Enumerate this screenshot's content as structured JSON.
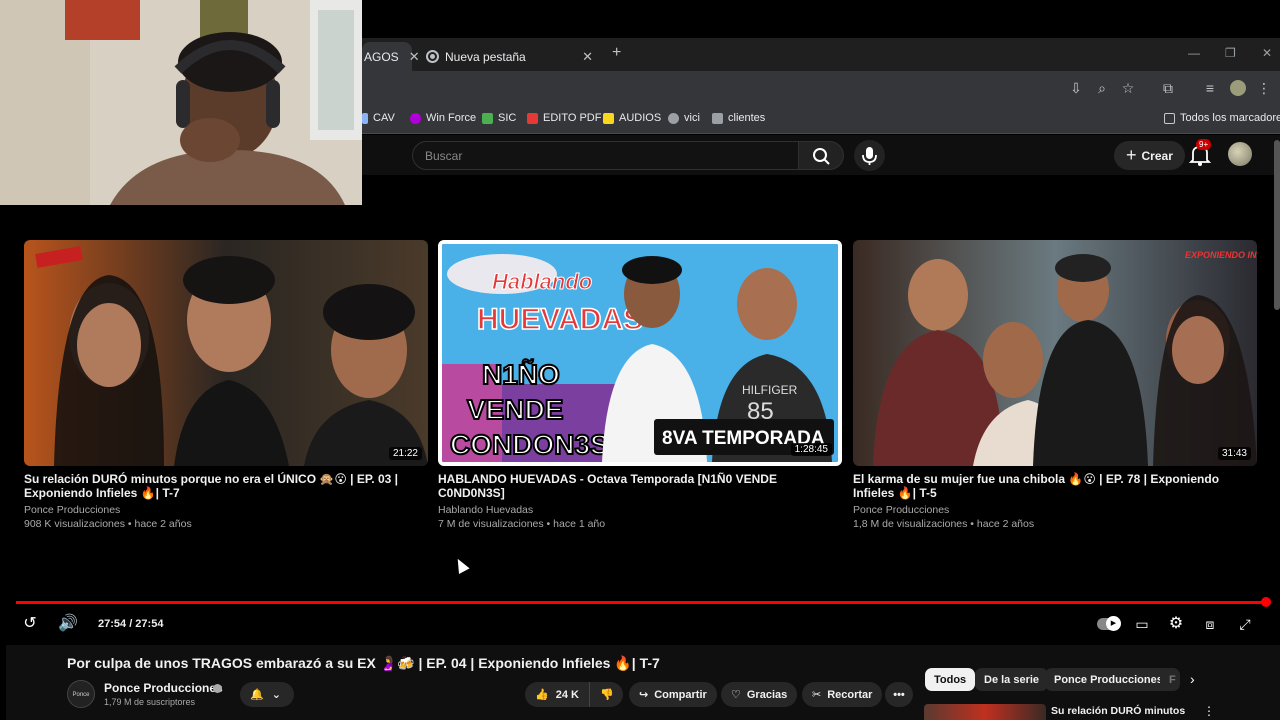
{
  "browser": {
    "tabs": [
      {
        "label": "AGOS",
        "close": "✕"
      },
      {
        "label": "Nueva pestaña",
        "close": "✕"
      }
    ],
    "new_tab": "+",
    "bookmarks": [
      {
        "label": "CAV",
        "color": "#8ab4f8"
      },
      {
        "label": "Win Force",
        "color": "#b000d8"
      },
      {
        "label": "SIC",
        "color": "#4caf50"
      },
      {
        "label": "EDITO PDF",
        "color": "#e53935"
      },
      {
        "label": "AUDIOS",
        "color": "#f9d71c"
      },
      {
        "label": "vici",
        "color": "#9aa0a6"
      },
      {
        "label": "clientes",
        "color": "#9aa0a6"
      }
    ],
    "all_bookmarks": "Todos los marcadores"
  },
  "youtube": {
    "search_placeholder": "Buscar",
    "create_label": "Crear",
    "notifications_badge": "9+"
  },
  "videos": [
    {
      "title": "Su relación DURÓ minutos porque no era el ÚNICO 🙊😮 | EP. 03 | Exponiendo Infieles 🔥| T-7",
      "channel": "Ponce Producciones",
      "meta": "908 K visualizaciones • hace 2 años",
      "duration": "21:22"
    },
    {
      "title": "HABLANDO HUEVADAS - Octava Temporada [N1Ñ0 VENDE C0ND0N3S]",
      "channel": "Hablando Huevadas",
      "meta": "7 M de visualizaciones • hace 1 año",
      "duration": "1:28:45",
      "thumb_text": {
        "brand": "Hablando HUEVADAS",
        "line1": "N1ÑO",
        "line2": "VENDE",
        "line3": "CONDON3S",
        "badge": "8VA TEMPORADA",
        "shirt": "HILFIGER 85"
      }
    },
    {
      "title": "El karma de su mujer fue una chibola 🔥😮 | EP. 78 | Exponiendo Infieles 🔥| T-5",
      "channel": "Ponce Producciones",
      "meta": "1,8 M de visualizaciones • hace 2 años",
      "duration": "31:43",
      "thumb_logo": "EXPONIENDO INFIELES"
    }
  ],
  "player": {
    "time": "27:54 / 27:54",
    "progress": 1.0,
    "accent": "#ff0000"
  },
  "current_video": {
    "title": "Por culpa de unos TRAGOS embarazó a su EX 🤰🍻 | EP. 04 | Exponiendo Infieles 🔥| T-7",
    "channel": "Ponce Producciones",
    "subscribers": "1,79 M de suscriptores",
    "likes": "24 K",
    "share": "Compartir",
    "thanks": "Gracias",
    "clip": "Recortar",
    "more": "•••"
  },
  "chips": [
    "Todos",
    "De la serie",
    "Ponce Producciones",
    "F"
  ],
  "recommendation": {
    "title": "Su relación DURÓ minutos"
  }
}
